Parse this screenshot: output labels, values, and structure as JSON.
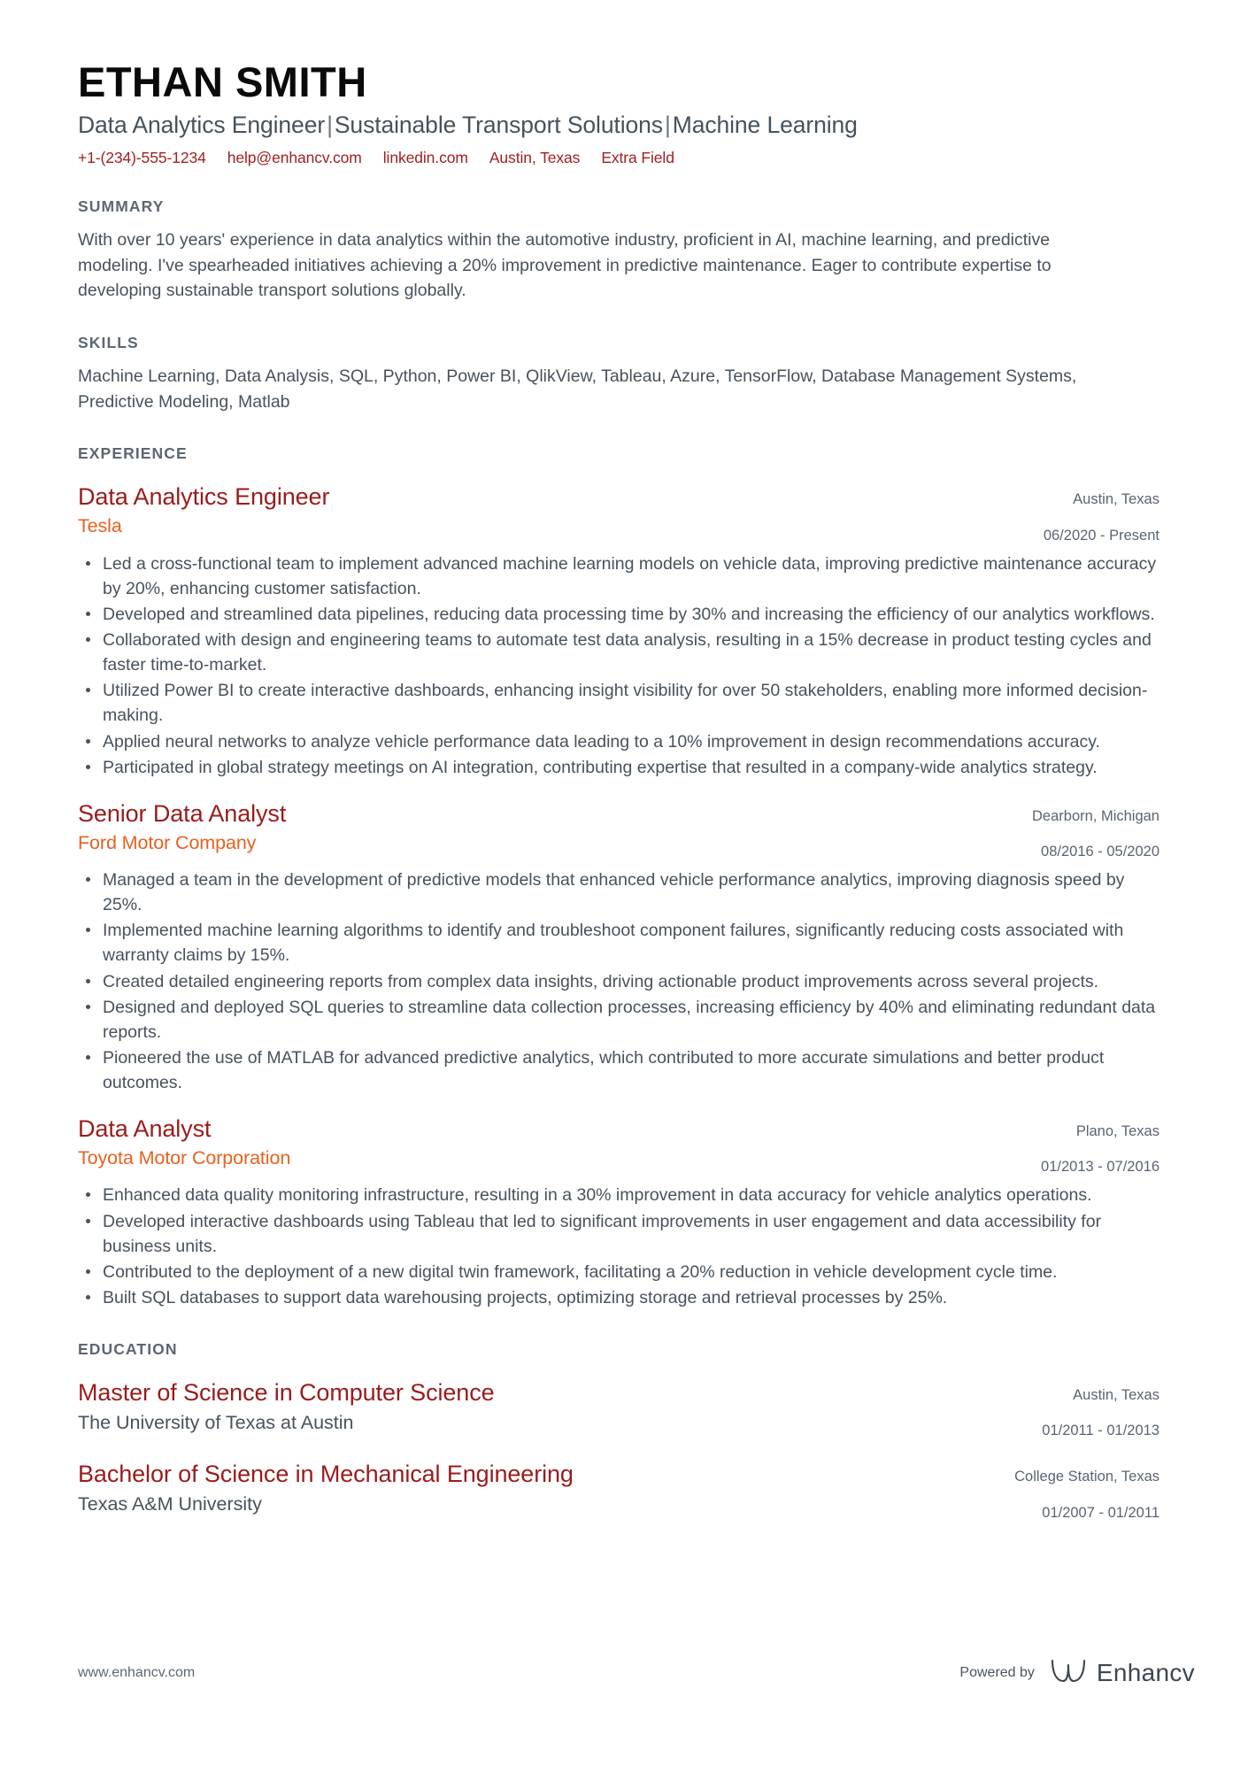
{
  "header": {
    "name": "ETHAN SMITH",
    "headline_parts": [
      "Data Analytics Engineer",
      "Sustainable Transport Solutions",
      "Machine Learning"
    ],
    "headline_separator": "|",
    "contacts": [
      {
        "label": "+1-(234)-555-1234",
        "name": "phone"
      },
      {
        "label": "help@enhancv.com",
        "name": "email"
      },
      {
        "label": "linkedin.com",
        "name": "linkedin"
      },
      {
        "label": "Austin, Texas",
        "name": "location"
      },
      {
        "label": "Extra Field",
        "name": "extra-field"
      }
    ]
  },
  "summary": {
    "title": "SUMMARY",
    "text": "With over 10 years' experience in data analytics within the automotive industry, proficient in AI, machine learning, and predictive modeling. I've spearheaded initiatives achieving a 20% improvement in predictive maintenance. Eager to contribute expertise to developing sustainable transport solutions globally."
  },
  "skills": {
    "title": "SKILLS",
    "text": "Machine Learning, Data Analysis, SQL, Python, Power BI, QlikView, Tableau, Azure, TensorFlow, Database Management Systems, Predictive Modeling, Matlab"
  },
  "experience": {
    "title": "EXPERIENCE",
    "entries": [
      {
        "role": "Data Analytics Engineer",
        "company": "Tesla",
        "location": "Austin, Texas",
        "dates": "06/2020 - Present",
        "bullets": [
          "Led a cross-functional team to implement advanced machine learning models on vehicle data, improving predictive maintenance accuracy by 20%, enhancing customer satisfaction.",
          "Developed and streamlined data pipelines, reducing data processing time by 30% and increasing the efficiency of our analytics workflows.",
          "Collaborated with design and engineering teams to automate test data analysis, resulting in a 15% decrease in product testing cycles and faster time-to-market.",
          "Utilized Power BI to create interactive dashboards, enhancing insight visibility for over 50 stakeholders, enabling more informed decision-making.",
          "Applied neural networks to analyze vehicle performance data leading to a 10% improvement in design recommendations accuracy.",
          "Participated in global strategy meetings on AI integration, contributing expertise that resulted in a company-wide analytics strategy."
        ]
      },
      {
        "role": "Senior Data Analyst",
        "company": "Ford Motor Company",
        "location": "Dearborn, Michigan",
        "dates": "08/2016 - 05/2020",
        "bullets": [
          "Managed a team in the development of predictive models that enhanced vehicle performance analytics, improving diagnosis speed by 25%.",
          "Implemented machine learning algorithms to identify and troubleshoot component failures, significantly reducing costs associated with warranty claims by 15%.",
          "Created detailed engineering reports from complex data insights, driving actionable product improvements across several projects.",
          "Designed and deployed SQL queries to streamline data collection processes, increasing efficiency by 40% and eliminating redundant data reports.",
          "Pioneered the use of MATLAB for advanced predictive analytics, which contributed to more accurate simulations and better product outcomes."
        ]
      },
      {
        "role": "Data Analyst",
        "company": "Toyota Motor Corporation",
        "location": "Plano, Texas",
        "dates": "01/2013 - 07/2016",
        "bullets": [
          "Enhanced data quality monitoring infrastructure, resulting in a 30% improvement in data accuracy for vehicle analytics operations.",
          "Developed interactive dashboards using Tableau that led to significant improvements in user engagement and data accessibility for business units.",
          "Contributed to the deployment of a new digital twin framework, facilitating a 20% reduction in vehicle development cycle time.",
          "Built SQL databases to support data warehousing projects, optimizing storage and retrieval processes by 25%."
        ]
      }
    ]
  },
  "education": {
    "title": "EDUCATION",
    "entries": [
      {
        "degree": "Master of Science in Computer Science",
        "school": "The University of Texas at Austin",
        "location": "Austin, Texas",
        "dates": "01/2011 - 01/2013"
      },
      {
        "degree": "Bachelor of Science in Mechanical Engineering",
        "school": "Texas A&M University",
        "location": "College Station, Texas",
        "dates": "01/2007 - 01/2011"
      }
    ]
  },
  "footer": {
    "url": "www.enhancv.com",
    "powered_by": "Powered by",
    "brand": "Enhancv"
  },
  "colors": {
    "role_red": "#9b1b1b",
    "company_orange": "#e8611f",
    "contact_red": "#a32020",
    "body_gray": "#47525d",
    "section_title_gray": "#5c6773"
  }
}
